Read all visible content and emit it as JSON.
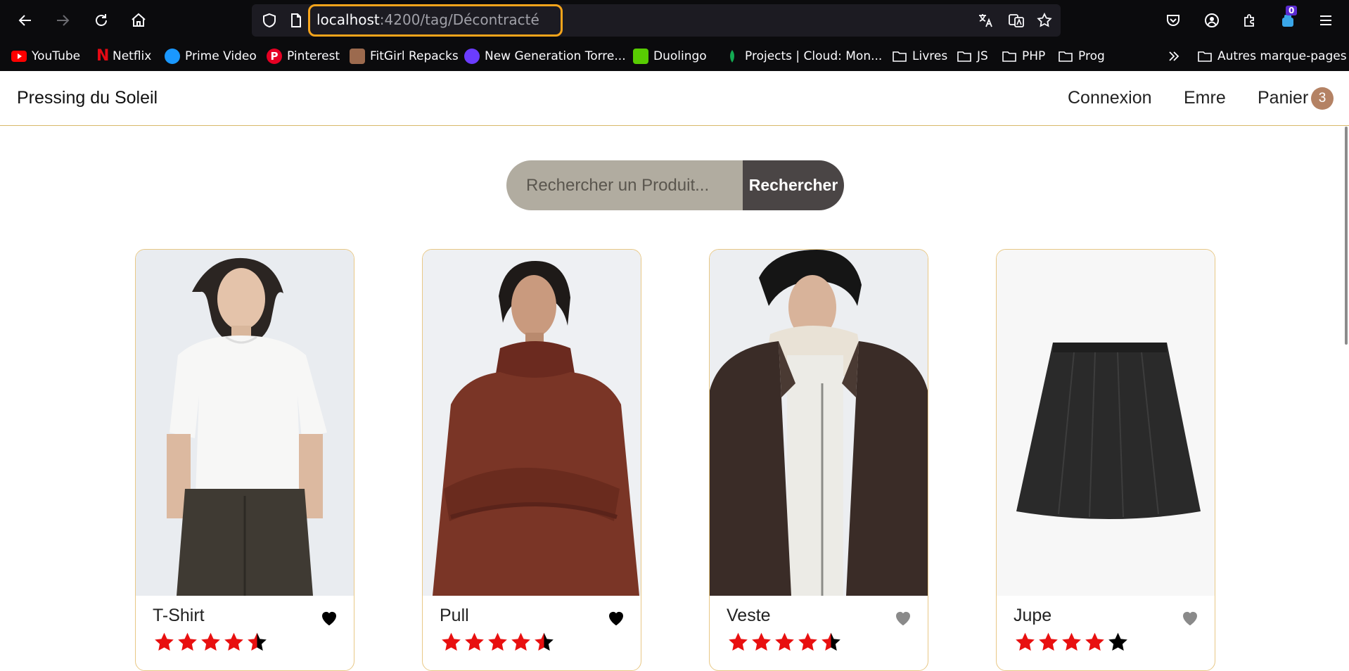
{
  "browser": {
    "url_host": "localhost",
    "url_path": ":4200/tag/Décontracté",
    "bookmarks": [
      {
        "label": "YouTube",
        "icon": "youtube-icon"
      },
      {
        "label": "Netflix",
        "icon": "netflix-icon"
      },
      {
        "label": "Prime Video",
        "icon": "prime-video-icon"
      },
      {
        "label": "Pinterest",
        "icon": "pinterest-icon"
      },
      {
        "label": "FitGirl Repacks",
        "icon": "fitgirl-icon"
      },
      {
        "label": "New Generation Torre...",
        "icon": "torrent-icon"
      },
      {
        "label": "Duolingo",
        "icon": "duolingo-icon"
      },
      {
        "label": "Projects | Cloud: Mon...",
        "icon": "mongodb-leaf-icon"
      },
      {
        "label": "Livres",
        "icon": "folder-icon"
      },
      {
        "label": "JS",
        "icon": "folder-icon"
      },
      {
        "label": "PHP",
        "icon": "folder-icon"
      },
      {
        "label": "Prog",
        "icon": "folder-icon"
      }
    ],
    "other_bookmarks": "Autres marque-pages",
    "extension_badge": "0"
  },
  "header": {
    "brand": "Pressing du Soleil",
    "login": "Connexion",
    "user": "Emre",
    "cart": "Panier",
    "cart_count": "3"
  },
  "search": {
    "placeholder": "Rechercher un Produit...",
    "button": "Rechercher"
  },
  "products": [
    {
      "name": "T-Shirt",
      "favorite": true,
      "rating": 4.5
    },
    {
      "name": "Pull",
      "favorite": true,
      "rating": 4.5
    },
    {
      "name": "Veste",
      "favorite": false,
      "rating": 4.5
    },
    {
      "name": "Jupe",
      "favorite": false,
      "rating": 4
    }
  ],
  "colors": {
    "url_highlight": "#f5a41b",
    "star_filled": "#e81010",
    "star_empty": "#000000",
    "heart_favorite": "#000000",
    "heart_default": "#8a8a8a",
    "card_border": "#e8c886",
    "cart_badge": "#b48264",
    "search_input_bg": "#b1aca0",
    "search_button_bg": "#4a4545"
  }
}
